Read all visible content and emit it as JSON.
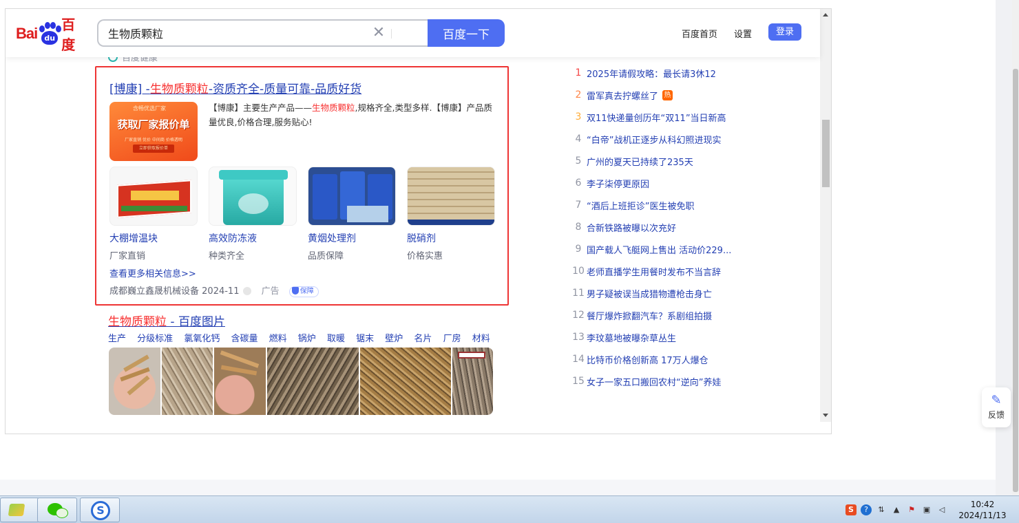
{
  "header": {
    "logo": {
      "bai": "Bai",
      "du": "du",
      "baidu_cn": "百度"
    },
    "search_value": "生物质颗粒",
    "search_button": "百度一下",
    "links": [
      "百度首页",
      "设置"
    ],
    "login": "登录"
  },
  "peek_text": "百度健康",
  "ad": {
    "title_prefix": "[博康] -",
    "title_hl": "生物质颗粒",
    "title_suffix": "-资质齐全-质量可靠-品质好货",
    "banner": {
      "tag": "含畅优选厂家",
      "main": "获取厂家报价单",
      "sub": "厂家直销 优价 中间商 价格透明",
      "btn": "立即获取报价单"
    },
    "desc_prefix": "【博康】主要生产产品——",
    "desc_hl": "生物质颗粒",
    "desc_suffix": ",规格齐全,类型多样.【博康】产品质量优良,价格合理,服务贴心!",
    "products": [
      {
        "name": "大棚增温块",
        "sub": "厂家直销"
      },
      {
        "name": "高效防冻液",
        "sub": "种类齐全"
      },
      {
        "name": "黄烟处理剂",
        "sub": "品质保障"
      },
      {
        "name": "脱硝剂",
        "sub": "价格实惠"
      }
    ],
    "more": "查看更多相关信息>>",
    "company": "成都巍立鑫晟机械设备",
    "date": "2024-11",
    "ad_label": "广告",
    "guarantee": "保障"
  },
  "image_result": {
    "title_hl": "生物质颗粒",
    "title_suffix": " - 百度图片",
    "tags": [
      "生产",
      "分级标准",
      "氯氧化钙",
      "含碳量",
      "燃料",
      "锅炉",
      "取暖",
      "锯末",
      "壁炉",
      "名片",
      "厂房",
      "材料"
    ]
  },
  "hot_list": [
    {
      "rank": "1",
      "title": "2025年请假攻略：最长请3休12",
      "color": "#f54545"
    },
    {
      "rank": "2",
      "title": "雷军真去拧螺丝了",
      "color": "#ff8547",
      "badge": "热"
    },
    {
      "rank": "3",
      "title": "双11快递量创历年“双11”当日新高",
      "color": "#ffac38"
    },
    {
      "rank": "4",
      "title": "“白帝”战机正逐步从科幻照进现实",
      "color": "#9195a3"
    },
    {
      "rank": "5",
      "title": "广州的夏天已持续了235天",
      "color": "#9195a3"
    },
    {
      "rank": "6",
      "title": "李子柒停更原因",
      "color": "#9195a3"
    },
    {
      "rank": "7",
      "title": "“酒后上班拒诊”医生被免职",
      "color": "#9195a3"
    },
    {
      "rank": "8",
      "title": "合新铁路被曝以次充好",
      "color": "#9195a3"
    },
    {
      "rank": "9",
      "title": "国产载人飞艇网上售出 活动价229...",
      "color": "#9195a3"
    },
    {
      "rank": "10",
      "title": "老师直播学生用餐时发布不当言辞",
      "color": "#9195a3"
    },
    {
      "rank": "11",
      "title": "男子疑被误当成猎物遭枪击身亡",
      "color": "#9195a3"
    },
    {
      "rank": "12",
      "title": "餐厅爆炸掀翻汽车？系剧组拍摄",
      "color": "#9195a3"
    },
    {
      "rank": "13",
      "title": "李玟墓地被曝杂草丛生",
      "color": "#9195a3"
    },
    {
      "rank": "14",
      "title": "比特币价格创新高 17万人爆仓",
      "color": "#9195a3"
    },
    {
      "rank": "15",
      "title": "女子一家五口搬回农村“逆向”养娃",
      "color": "#9195a3"
    }
  ],
  "feedback": "反馈",
  "taskbar": {
    "time": "10:42",
    "date": "2024/11/13"
  }
}
